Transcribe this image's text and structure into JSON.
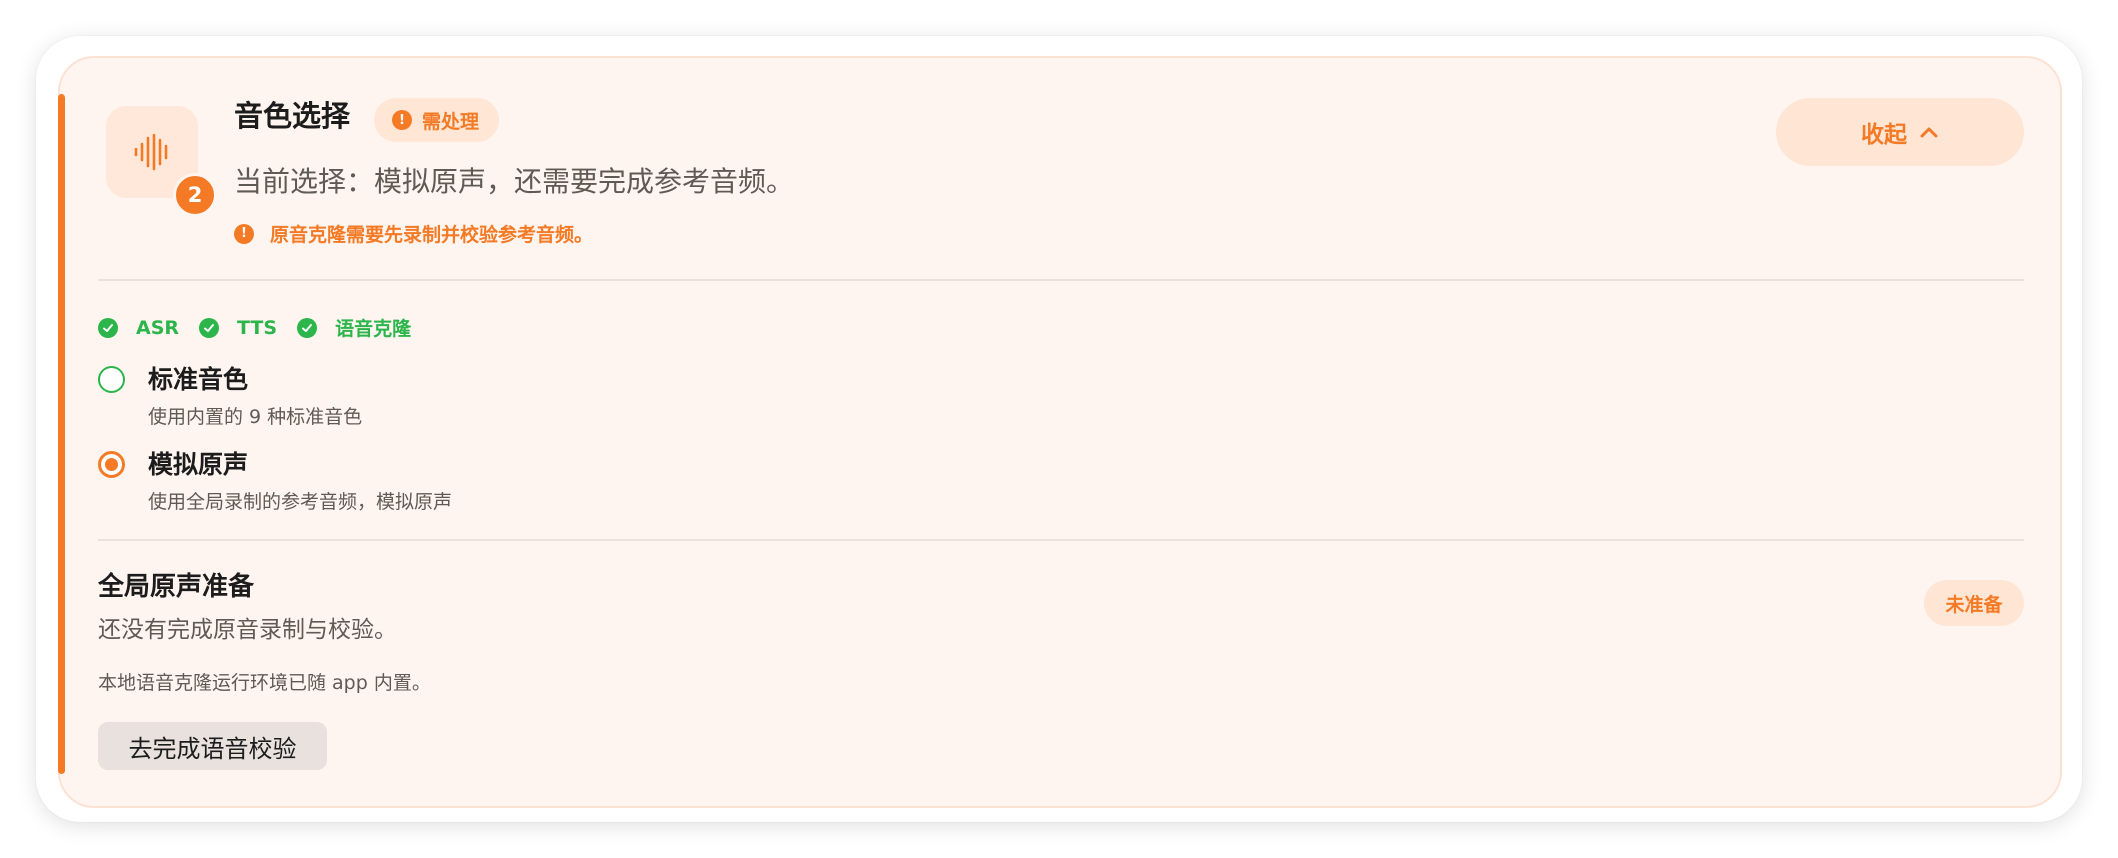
{
  "colors": {
    "accent": "#f47a25",
    "success": "#2bb54a",
    "card_bg": "#fff5f0"
  },
  "header": {
    "icon": "audio-waveform-icon",
    "step_badge": "2",
    "title": "音色选择",
    "status": "需处理",
    "current_selection": "当前选择：模拟原声，还需要完成参考音频。",
    "warning": "原音克隆需要先录制并校验参考音频。",
    "collapse_label": "收起"
  },
  "capabilities": [
    {
      "label": "ASR",
      "status": "ok"
    },
    {
      "label": "TTS",
      "status": "ok"
    },
    {
      "label": "语音克隆",
      "status": "ok"
    }
  ],
  "voice_options": [
    {
      "title": "标准音色",
      "description": "使用内置的 9 种标准音色",
      "selected": false
    },
    {
      "title": "模拟原声",
      "description": "使用全局录制的参考音频，模拟原声",
      "selected": true
    }
  ],
  "global_prep": {
    "title": "全局原声准备",
    "description": "还没有完成原音录制与校验。",
    "note": "本地语音克隆运行环境已随 app 内置。",
    "status_badge": "未准备",
    "action_label": "去完成语音校验"
  }
}
